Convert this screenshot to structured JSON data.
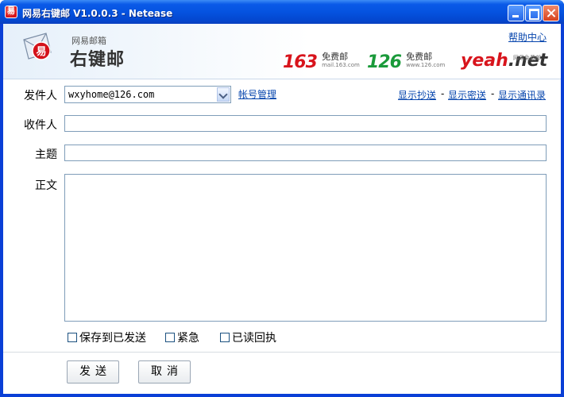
{
  "window": {
    "title": "网易右键邮 V1.0.0.3 - Netease",
    "app_icon_glyph": "易"
  },
  "header": {
    "logo_sub": "网易邮箱",
    "logo_main": "右键邮",
    "help_link": "帮助中心",
    "brands": [
      {
        "num": "163",
        "tag": "免费邮",
        "domain": "mail.163.com"
      },
      {
        "num": "126",
        "tag": "免费邮",
        "domain": "www.126.com"
      },
      {
        "num": "yeah",
        "suffix": ".net",
        "tag": "网易免费邮"
      }
    ]
  },
  "form": {
    "sender_label": "发件人",
    "sender_value": "wxyhome@126.com",
    "account_manage": "帐号管理",
    "show_cc": "显示抄送",
    "show_bcc": "显示密送",
    "show_contacts": "显示通讯录",
    "separator": "-",
    "recipient_label": "收件人",
    "recipient_value": "",
    "subject_label": "主题",
    "subject_value": "",
    "body_label": "正文",
    "body_value": ""
  },
  "options": {
    "save_sent": "保存到已发送",
    "urgent": "紧急",
    "read_receipt": "已读回执"
  },
  "buttons": {
    "send": "发送",
    "cancel": "取消"
  },
  "colors": {
    "titlebar": "#0553e0",
    "link": "#0645ad",
    "brand_red": "#d8141c",
    "brand_green": "#1a9a3a"
  }
}
